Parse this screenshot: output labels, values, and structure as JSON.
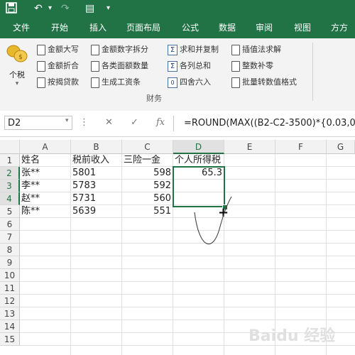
{
  "quick_access": {
    "save_icon": "save-icon",
    "undo_icon": "undo-icon",
    "redo_icon": "redo-icon",
    "form_icon": "form-icon",
    "more_icon": "customize-icon"
  },
  "tabs": [
    "文件",
    "开始",
    "插入",
    "页面布局",
    "公式",
    "数据",
    "审阅",
    "视图",
    "方方格"
  ],
  "ribbon": {
    "big_button_label": "个税",
    "buttons": [
      "金额大写",
      "金额数字拆分",
      "求和并复制",
      "插值法求解",
      "金额折合",
      "各类面额数量",
      "各列总和",
      "整数补零",
      "按揭贷款",
      "生成工资条",
      "四舍六入",
      "批量转数值格式"
    ],
    "group_label": "财务"
  },
  "formula_bar": {
    "name_box": "D2",
    "cancel": "✕",
    "enter": "✓",
    "fx": "fx",
    "formula": "=ROUND(MAX((B2-C2-3500)*{0.03,0"
  },
  "columns": [
    "A",
    "B",
    "C",
    "D",
    "E",
    "F",
    "G"
  ],
  "rows": [
    "1",
    "2",
    "3",
    "4",
    "5",
    "6",
    "7",
    "8",
    "9",
    "10",
    "11",
    "12",
    "13",
    "14",
    "15"
  ],
  "cells": {
    "A1": "姓名",
    "B1": "税前收入",
    "C1": "三险一金",
    "D1": "个人所得税",
    "A2": "张**",
    "B2": "5801",
    "C2": "598",
    "D2": "65.3",
    "A3": "李**",
    "B3": "5783",
    "C3": "592",
    "A4": "赵**",
    "B4": "5731",
    "C4": "560",
    "A5": "陈**",
    "B5": "5639",
    "C5": "551"
  },
  "watermark": "Baidu 经验",
  "colors": {
    "accent": "#217346"
  }
}
